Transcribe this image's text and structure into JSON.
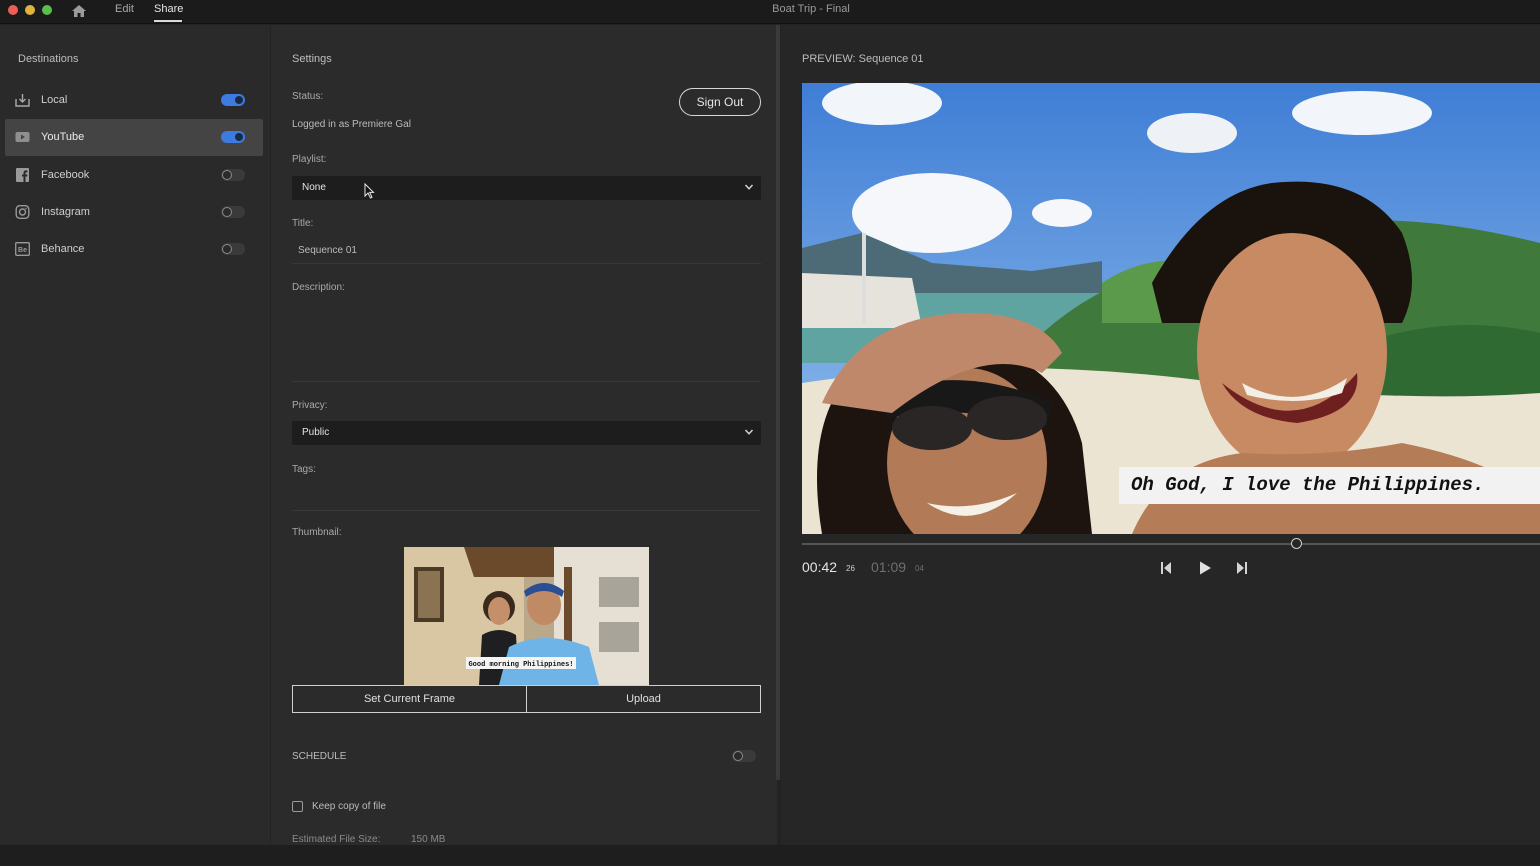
{
  "titlebar": {
    "menu": [
      {
        "label": "Edit"
      },
      {
        "label": "Share"
      }
    ],
    "title": "Boat Trip - Final"
  },
  "destinations": {
    "header": "Destinations",
    "items": [
      {
        "label": "Local",
        "icon": "local-export-icon",
        "enabled": true
      },
      {
        "label": "YouTube",
        "icon": "youtube-icon",
        "enabled": true
      },
      {
        "label": "Facebook",
        "icon": "facebook-icon",
        "enabled": false
      },
      {
        "label": "Instagram",
        "icon": "instagram-icon",
        "enabled": false
      },
      {
        "label": "Behance",
        "icon": "behance-icon",
        "enabled": false
      }
    ]
  },
  "settings": {
    "header": "Settings",
    "status_label": "Status:",
    "status_value": "Logged in as Premiere Gal",
    "sign_out_label": "Sign Out",
    "playlist_label": "Playlist:",
    "playlist_value": "None",
    "title_label": "Title:",
    "title_value": "Sequence 01",
    "description_label": "Description:",
    "privacy_label": "Privacy:",
    "privacy_value": "Public",
    "tags_label": "Tags:",
    "thumbnail_label": "Thumbnail:",
    "thumbnail_caption": "Good morning Philippines!",
    "set_frame_label": "Set Current Frame",
    "upload_label": "Upload",
    "schedule_label": "SCHEDULE",
    "schedule_enabled": false,
    "keep_copy_label": "Keep copy of file",
    "keep_copy_checked": false,
    "file_size_label": "Estimated File Size:",
    "file_size_value": "150 MB"
  },
  "preview": {
    "header": "PREVIEW: Sequence 01",
    "caption": "Oh God, I love the Philippines.",
    "current_time": "00:42",
    "current_frames": "26",
    "duration_time": "01:09",
    "duration_frames": "04",
    "playhead_fraction": 0.67
  },
  "colors": {
    "accent": "#3d7be0",
    "panel": "#2b2b2b",
    "selected_row": "#444444"
  }
}
